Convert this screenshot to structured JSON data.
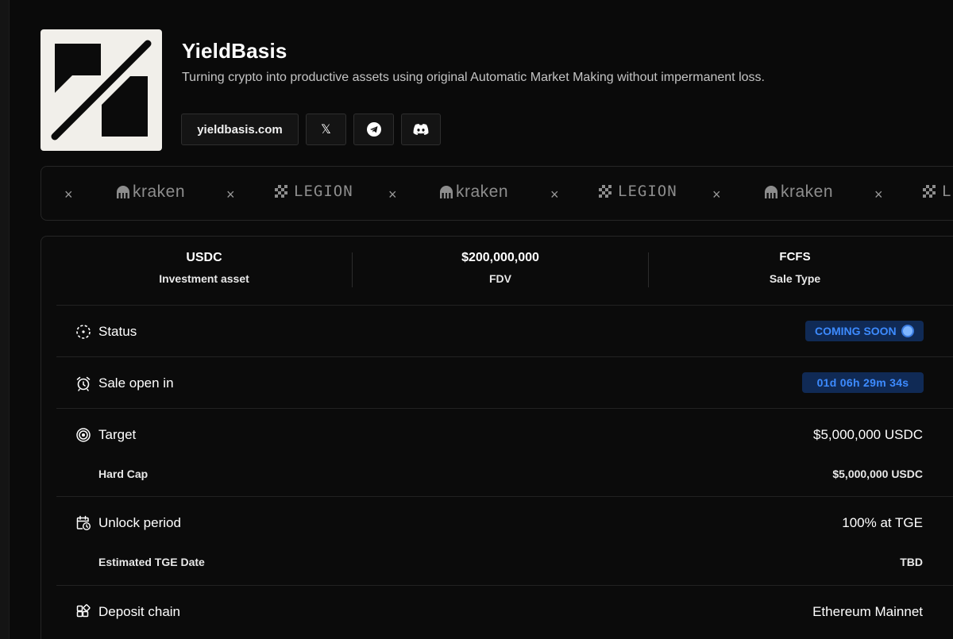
{
  "project": {
    "name": "YieldBasis",
    "description": "Turning crypto into productive assets using original Automatic Market Making without impermanent loss.",
    "website_label": "yieldbasis.com"
  },
  "socials": [
    {
      "name": "x",
      "glyph": "𝕏"
    },
    {
      "name": "telegram"
    },
    {
      "name": "discord"
    }
  ],
  "partners": {
    "separator": "×",
    "items": [
      {
        "name": "kraken",
        "label": "kraken"
      },
      {
        "name": "legion",
        "label": "LEGION"
      },
      {
        "name": "kraken",
        "label": "kraken"
      },
      {
        "name": "legion",
        "label": "LEGION"
      },
      {
        "name": "kraken",
        "label": "kraken"
      },
      {
        "name": "legion",
        "label": "L"
      }
    ]
  },
  "stats": [
    {
      "value": "USDC",
      "label": "Investment asset"
    },
    {
      "value": "$200,000,000",
      "label": "FDV"
    },
    {
      "value": "FCFS",
      "label": "Sale Type"
    }
  ],
  "rows": {
    "status": {
      "label": "Status",
      "badge": "COMING SOON"
    },
    "sale_open": {
      "label": "Sale open in",
      "countdown": "01d 06h 29m 34s"
    },
    "target": {
      "label": "Target",
      "value": "$5,000,000 USDC",
      "sub_label": "Hard Cap",
      "sub_value": "$5,000,000 USDC"
    },
    "unlock": {
      "label": "Unlock period",
      "value": "100% at TGE",
      "sub_label": "Estimated TGE Date",
      "sub_value": "TBD"
    },
    "deposit": {
      "label": "Deposit chain",
      "value": "Ethereum Mainnet"
    }
  },
  "colors": {
    "background": "#0a0a0a",
    "badge_bg": "#102a55",
    "badge_text": "#3d8bff",
    "logo_bg": "#f1efea"
  }
}
